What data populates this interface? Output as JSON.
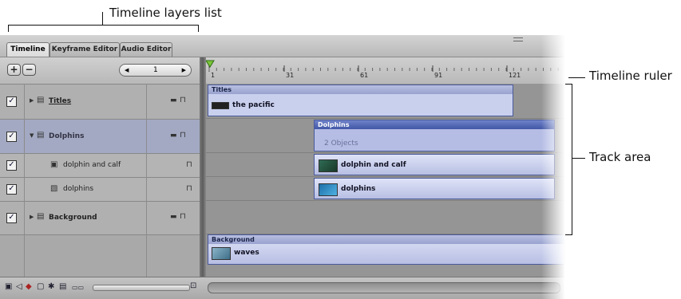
{
  "callouts": {
    "layers_list": "Timeline layers list",
    "ruler": "Timeline ruler",
    "track_area": "Track area"
  },
  "tabs": [
    {
      "label": "Timeline",
      "active": true
    },
    {
      "label": "Keyframe Editor",
      "active": false
    },
    {
      "label": "Audio Editor",
      "active": false
    }
  ],
  "controls": {
    "add_symbol": "+",
    "remove_symbol": "−",
    "frame_value": "1"
  },
  "layers": [
    {
      "name": "Titles",
      "checked": true,
      "disclosure": "▶",
      "icon": "group-icon"
    },
    {
      "name": "Dolphins",
      "checked": true,
      "disclosure": "▼",
      "icon": "group-icon",
      "selected": true
    },
    {
      "name": "dolphin and calf",
      "checked": true,
      "icon": "film-icon"
    },
    {
      "name": "dolphins",
      "checked": true,
      "icon": "image-icon"
    },
    {
      "name": "Background",
      "checked": true,
      "disclosure": "▶",
      "icon": "group-icon"
    }
  ],
  "ruler": {
    "labels": [
      "1",
      "31",
      "61",
      "91",
      "121"
    ]
  },
  "tracks": {
    "titles_header": "Titles",
    "titles_clip": "the pacific",
    "dolphins_header": "Dolphins",
    "dolphins_objects": "2 Objects",
    "clip_dolphin_calf": "dolphin and calf",
    "clip_dolphins": "dolphins",
    "background_header": "Background",
    "background_clip": "waves"
  },
  "colors": {
    "clip_blue": "#b7bfe3",
    "header_blue": "#4257a6",
    "playhead": "#7bc43a"
  }
}
